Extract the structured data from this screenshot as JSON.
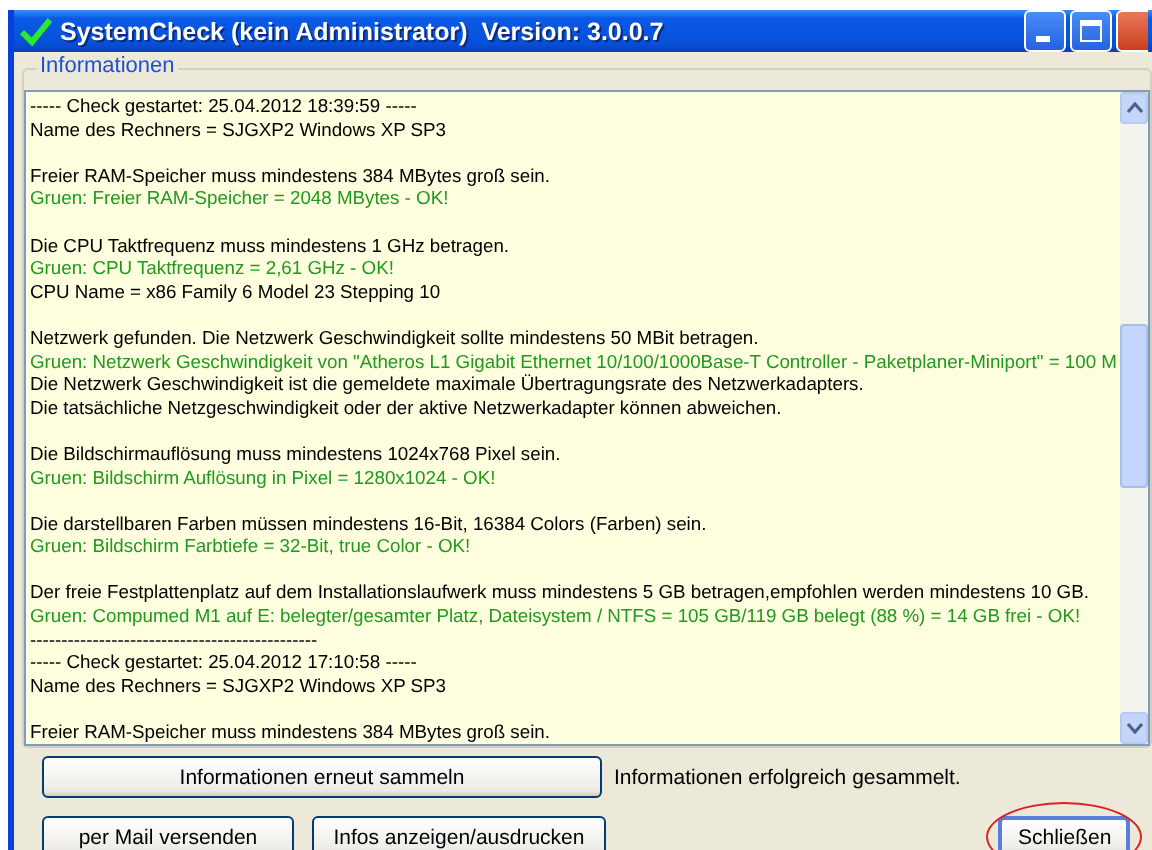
{
  "window": {
    "title": "SystemCheck (kein Administrator)  Version: 3.0.0.7"
  },
  "group": {
    "label": "Informationen"
  },
  "log": {
    "blocks": [
      {
        "lines": [
          {
            "text": "----- Check gestartet: 25.04.2012 18:39:59 -----",
            "kind": "normal"
          },
          {
            "text": "Name des Rechners = SJGXP2 Windows XP SP3",
            "kind": "normal"
          }
        ]
      },
      {
        "lines": [
          {
            "text": "Freier RAM-Speicher muss mindestens 384 MBytes groß sein.",
            "kind": "normal"
          },
          {
            "text": "Gruen: Freier RAM-Speicher = 2048 MBytes - OK!",
            "kind": "ok"
          }
        ]
      },
      {
        "lines": [
          {
            "text": "Die CPU Taktfrequenz muss mindestens 1 GHz betragen.",
            "kind": "normal"
          },
          {
            "text": "Gruen: CPU Taktfrequenz = 2,61 GHz - OK!",
            "kind": "ok"
          },
          {
            "text": "CPU Name = x86 Family 6 Model 23 Stepping 10",
            "kind": "normal"
          }
        ]
      },
      {
        "lines": [
          {
            "text": "Netzwerk gefunden. Die Netzwerk Geschwindigkeit sollte mindestens 50 MBit betragen.",
            "kind": "normal"
          },
          {
            "text": "Gruen: Netzwerk Geschwindigkeit von \"Atheros L1 Gigabit Ethernet 10/100/1000Base-T Controller - Paketplaner-Miniport\" = 100 M",
            "kind": "ok"
          },
          {
            "text": "Die Netzwerk Geschwindigkeit ist die gemeldete maximale Übertragungsrate des Netzwerkadapters.",
            "kind": "normal"
          },
          {
            "text": "Die tatsächliche Netzgeschwindigkeit oder der aktive Netzwerkadapter können abweichen.",
            "kind": "normal"
          }
        ]
      },
      {
        "lines": [
          {
            "text": "Die Bildschirmauflösung muss mindestens 1024x768 Pixel sein.",
            "kind": "normal"
          },
          {
            "text": "Gruen: Bildschirm Auflösung in Pixel = 1280x1024 - OK!",
            "kind": "ok"
          }
        ]
      },
      {
        "lines": [
          {
            "text": "Die darstellbaren Farben müssen mindestens 16-Bit, 16384 Colors (Farben) sein.",
            "kind": "normal"
          },
          {
            "text": "Gruen: Bildschirm Farbtiefe = 32-Bit, true Color - OK!",
            "kind": "ok"
          }
        ]
      },
      {
        "lines": [
          {
            "text": "Der freie Festplattenplatz auf dem Installationslaufwerk muss mindestens 5 GB betragen,empfohlen werden mindestens 10 GB.",
            "kind": "normal"
          },
          {
            "text": "Gruen: Compumed M1 auf E: belegter/gesamter Platz, Dateisystem / NTFS = 105 GB/119 GB belegt (88 %) = 14 GB frei - OK!",
            "kind": "ok"
          },
          {
            "text": "----------------------------------------------",
            "kind": "normal"
          },
          {
            "text": "----- Check gestartet: 25.04.2012 17:10:58 -----",
            "kind": "normal"
          },
          {
            "text": "Name des Rechners = SJGXP2 Windows XP SP3",
            "kind": "normal"
          }
        ]
      },
      {
        "lines": [
          {
            "text": "Freier RAM-Speicher muss mindestens 384 MBytes groß sein.",
            "kind": "normal"
          }
        ]
      }
    ]
  },
  "collect_button": {
    "label": "Informationen erneut sammeln"
  },
  "status": "Informationen erfolgreich gesammelt.",
  "buttons": [
    {
      "label": "per Mail versenden",
      "highlighted": false
    },
    {
      "label": "Infos anzeigen/ausdrucken",
      "highlighted": false
    },
    {
      "label": "Schließen",
      "highlighted": true
    }
  ]
}
